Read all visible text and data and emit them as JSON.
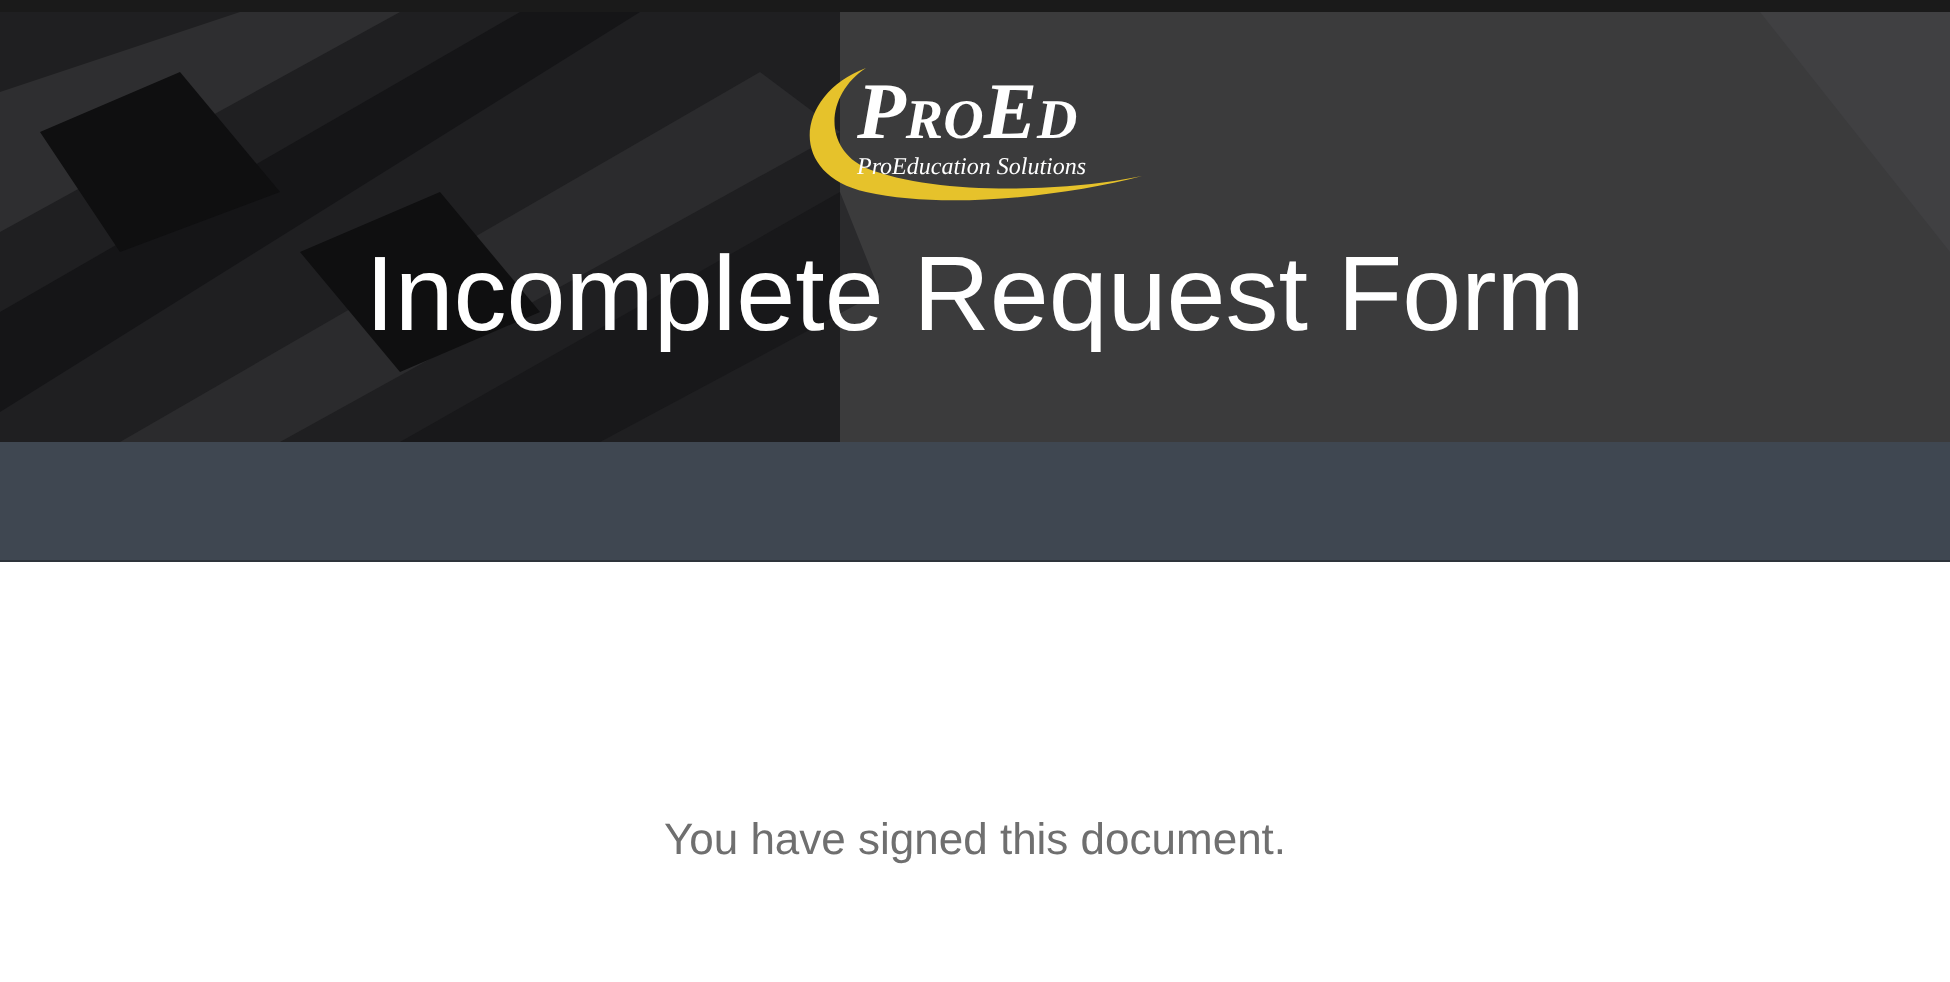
{
  "header": {
    "logo": {
      "name": "ProEd",
      "tagline": "ProEducation Solutions"
    },
    "title": "Incomplete Request Form"
  },
  "message": "You have signed this document."
}
